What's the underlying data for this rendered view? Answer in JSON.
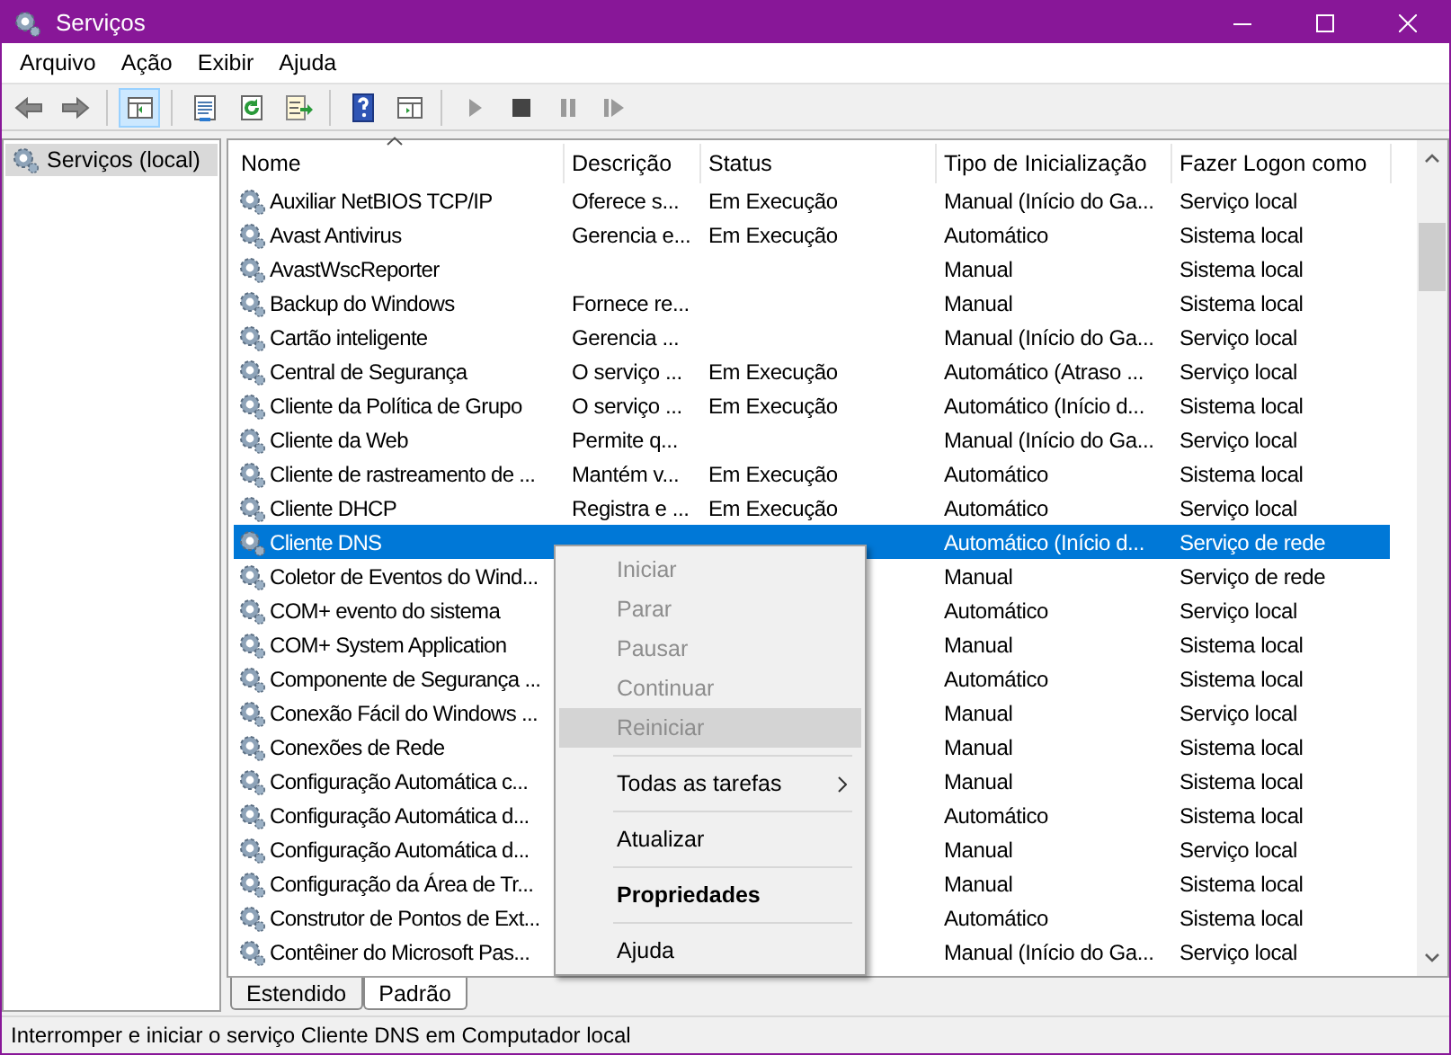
{
  "window": {
    "title": "Serviços"
  },
  "menu_bar": [
    "Arquivo",
    "Ação",
    "Exibir",
    "Ajuda"
  ],
  "toolbar": [
    {
      "kind": "back",
      "disabled": false
    },
    {
      "kind": "forward",
      "disabled": false
    },
    {
      "kind": "separator"
    },
    {
      "kind": "tree",
      "selected": true
    },
    {
      "kind": "separator"
    },
    {
      "kind": "properties",
      "selected": false
    },
    {
      "kind": "refresh",
      "selected": false
    },
    {
      "kind": "export",
      "selected": false
    },
    {
      "kind": "separator"
    },
    {
      "kind": "help",
      "selected": false
    },
    {
      "kind": "view",
      "selected": false
    },
    {
      "kind": "separator"
    },
    {
      "kind": "play",
      "selected": false
    },
    {
      "kind": "stop",
      "selected": false
    },
    {
      "kind": "pause",
      "selected": false
    },
    {
      "kind": "resume",
      "selected": false
    }
  ],
  "tree": {
    "items": [
      {
        "label": "Serviços (local)",
        "selected": true
      }
    ]
  },
  "table": {
    "columns": [
      "Nome",
      "Descrição",
      "Status",
      "Tipo de Inicialização",
      "Fazer Logon como"
    ],
    "rows": [
      {
        "name": "Auxiliar NetBIOS TCP/IP",
        "description": "Oferece s...",
        "status": "Em Execução",
        "startup": "Manual (Início do Ga...",
        "logon": "Serviço local",
        "selected": false
      },
      {
        "name": "Avast Antivirus",
        "description": "Gerencia e...",
        "status": "Em Execução",
        "startup": "Automático",
        "logon": "Sistema local",
        "selected": false
      },
      {
        "name": "AvastWscReporter",
        "startup": "Manual",
        "logon": "Sistema local",
        "selected": false
      },
      {
        "name": "Backup do Windows",
        "description": "Fornece re...",
        "startup": "Manual",
        "logon": "Sistema local",
        "selected": false
      },
      {
        "name": "Cartão inteligente",
        "description": "Gerencia ...",
        "startup": "Manual (Início do Ga...",
        "logon": "Serviço local",
        "selected": false
      },
      {
        "name": "Central de Segurança",
        "description": "O serviço ...",
        "status": "Em Execução",
        "startup": "Automático (Atraso ...",
        "logon": "Serviço local",
        "selected": false
      },
      {
        "name": "Cliente da Política de Grupo",
        "description": "O serviço ...",
        "status": "Em Execução",
        "startup": "Automático (Início d...",
        "logon": "Sistema local",
        "selected": false
      },
      {
        "name": "Cliente da Web",
        "description": "Permite q...",
        "startup": "Manual (Início do Ga...",
        "logon": "Serviço local",
        "selected": false
      },
      {
        "name": "Cliente de rastreamento de ...",
        "description": "Mantém v...",
        "status": "Em Execução",
        "startup": "Automático",
        "logon": "Sistema local",
        "selected": false
      },
      {
        "name": "Cliente DHCP",
        "description": "Registra e ...",
        "status": "Em Execução",
        "startup": "Automático",
        "logon": "Serviço local",
        "selected": false
      },
      {
        "name": "Cliente DNS",
        "startup": "Automático (Início d...",
        "logon": "Serviço de rede",
        "selected": true
      },
      {
        "name": "Coletor de Eventos do Wind...",
        "startup": "Manual",
        "logon": "Serviço de rede",
        "selected": false
      },
      {
        "name": "COM+ evento do sistema",
        "startup": "Automático",
        "logon": "Serviço local",
        "selected": false
      },
      {
        "name": "COM+ System Application",
        "startup": "Manual",
        "logon": "Sistema local",
        "selected": false
      },
      {
        "name": "Componente de Segurança ...",
        "startup": "Automático",
        "logon": "Sistema local",
        "selected": false
      },
      {
        "name": "Conexão Fácil do Windows ...",
        "startup": "Manual",
        "logon": "Serviço local",
        "selected": false
      },
      {
        "name": "Conexões de Rede",
        "startup": "Manual",
        "logon": "Sistema local",
        "selected": false
      },
      {
        "name": "Configuração Automática c...",
        "startup": "Manual",
        "logon": "Sistema local",
        "selected": false
      },
      {
        "name": "Configuração Automática d...",
        "startup": "Automático",
        "logon": "Sistema local",
        "selected": false
      },
      {
        "name": "Configuração Automática d...",
        "startup": "Manual",
        "logon": "Serviço local",
        "selected": false
      },
      {
        "name": "Configuração da Área de Tr...",
        "startup": "Manual",
        "logon": "Sistema local",
        "selected": false
      },
      {
        "name": "Construtor de Pontos de Ext...",
        "startup": "Automático",
        "logon": "Sistema local",
        "selected": false
      },
      {
        "name": "Contêiner do Microsoft Pas...",
        "startup": "Manual (Início do Ga...",
        "logon": "Serviço local",
        "selected": false
      }
    ]
  },
  "context_menu": [
    {
      "kind": "item",
      "label": "Iniciar",
      "disabled": true,
      "highlighted": false
    },
    {
      "kind": "item",
      "label": "Parar",
      "disabled": true,
      "highlighted": false
    },
    {
      "kind": "item",
      "label": "Pausar",
      "disabled": true,
      "highlighted": false
    },
    {
      "kind": "item",
      "label": "Continuar",
      "disabled": true,
      "highlighted": false
    },
    {
      "kind": "item",
      "label": "Reiniciar",
      "disabled": true,
      "highlighted": true
    },
    {
      "kind": "separator"
    },
    {
      "kind": "item",
      "label": "Todas as tarefas",
      "disabled": false,
      "highlighted": false,
      "submenu": true
    },
    {
      "kind": "separator"
    },
    {
      "kind": "item",
      "label": "Atualizar",
      "disabled": false,
      "highlighted": false
    },
    {
      "kind": "separator"
    },
    {
      "kind": "item",
      "label": "Propriedades",
      "disabled": false,
      "highlighted": false,
      "default": true
    },
    {
      "kind": "separator"
    },
    {
      "kind": "item",
      "label": "Ajuda",
      "disabled": false,
      "highlighted": false
    }
  ],
  "view_tabs": [
    {
      "label": "Estendido",
      "selected": false
    },
    {
      "label": "Padrão",
      "selected": true
    }
  ],
  "status_bar": "Interromper e iniciar o serviço Cliente DNS em Computador local"
}
